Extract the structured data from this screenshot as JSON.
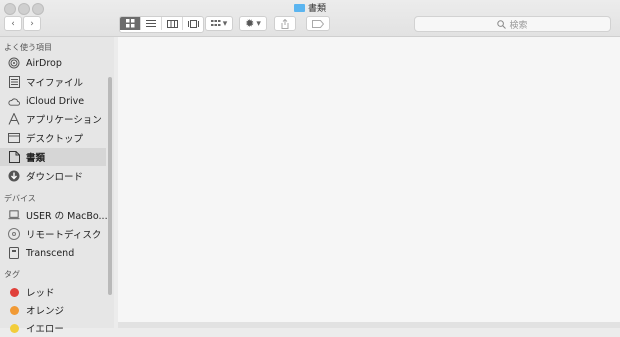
{
  "window": {
    "title": "書類",
    "accent": "#5bb5f0"
  },
  "toolbar": {
    "back": "‹",
    "forward": "›",
    "views": [
      "grid-view-icon",
      "list-view-icon",
      "column-view-icon",
      "gallery-view-icon"
    ],
    "group_label": "▾",
    "action_label": "▾",
    "search_placeholder": "検索"
  },
  "sidebar": {
    "favorites_header": "よく使う項目",
    "favorites": [
      {
        "label": "AirDrop",
        "icon": "airdrop-icon"
      },
      {
        "label": "マイファイル",
        "icon": "all-files-icon"
      },
      {
        "label": "iCloud Drive",
        "icon": "cloud-icon"
      },
      {
        "label": "アプリケーション",
        "icon": "applications-icon"
      },
      {
        "label": "デスクトップ",
        "icon": "desktop-icon"
      },
      {
        "label": "書類",
        "icon": "documents-icon",
        "selected": true
      },
      {
        "label": "ダウンロード",
        "icon": "download-icon"
      }
    ],
    "devices_header": "デバイス",
    "devices": [
      {
        "label": "USER の MacBo...",
        "icon": "laptop-icon"
      },
      {
        "label": "リモートディスク",
        "icon": "disc-icon"
      },
      {
        "label": "Transcend",
        "icon": "drive-icon"
      }
    ],
    "tags_header": "タグ",
    "tags": [
      {
        "label": "レッド",
        "color": "#e0403a"
      },
      {
        "label": "オレンジ",
        "color": "#f19a35"
      },
      {
        "label": "イエロー",
        "color": "#f2cd3b"
      }
    ]
  }
}
